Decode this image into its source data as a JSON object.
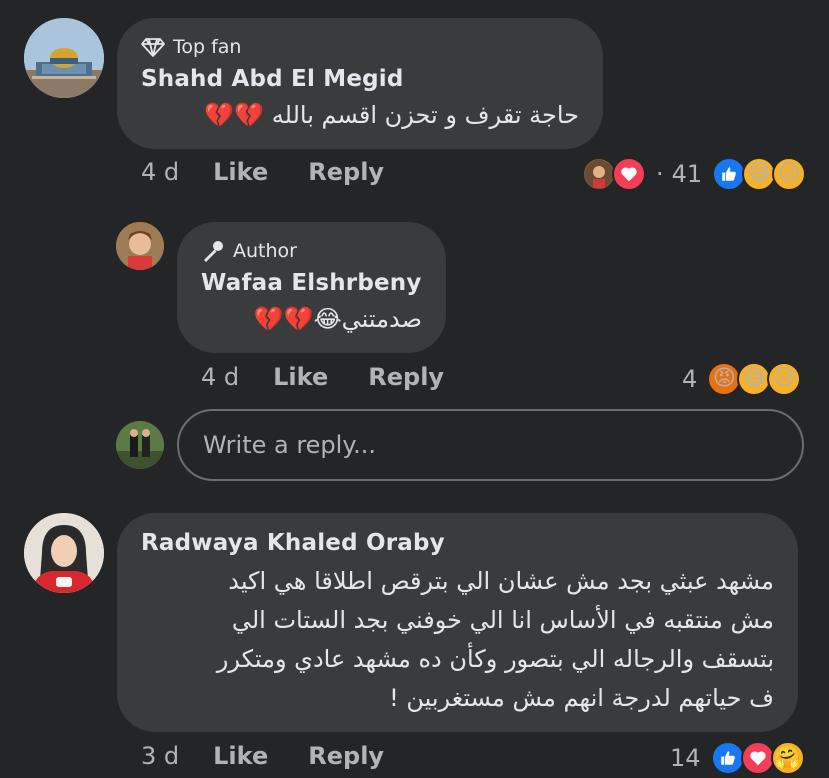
{
  "comments": [
    {
      "badge": "Top fan",
      "author": "Shahd Abd El Megid",
      "text": "حاجة تقرف و تحزن اقسم بالله 💔💔",
      "time": "4 d",
      "like": "Like",
      "reply": "Reply",
      "reaction_count": "41",
      "reaction_dot": "·"
    },
    {
      "badge": "Author",
      "author": "Wafaa Elshrbeny",
      "text": "صدمتني😂💔💔",
      "time": "4 d",
      "like": "Like",
      "reply": "Reply",
      "reaction_count": "4"
    },
    {
      "author": "Radwaya Khaled Oraby",
      "lines": [
        "مشهد عبثي بجد مش عشان الي بترقص اطلاقا هي اكيد",
        "مش منتقبه في الأساس انا الي خوفني بجد الستات الي",
        "بتسقف والرجاله الي بتصور وكأن ده مشهد عادي ومتكرر",
        "ف حياتهم لدرجة انهم مش مستغربين !"
      ],
      "time": "3 d",
      "like": "Like",
      "reply": "Reply",
      "reaction_count": "14"
    }
  ],
  "reply_box": {
    "placeholder": "Write a reply..."
  },
  "colors": {
    "background": "#242526",
    "bubble": "#3a3b3c",
    "text": "#e4e6eb",
    "muted": "#b0b3b8",
    "like_blue": "#1877f2",
    "love_red": "#f33e58",
    "haha_yellow": "#f7b125",
    "angry_orange": "#e9710f"
  }
}
